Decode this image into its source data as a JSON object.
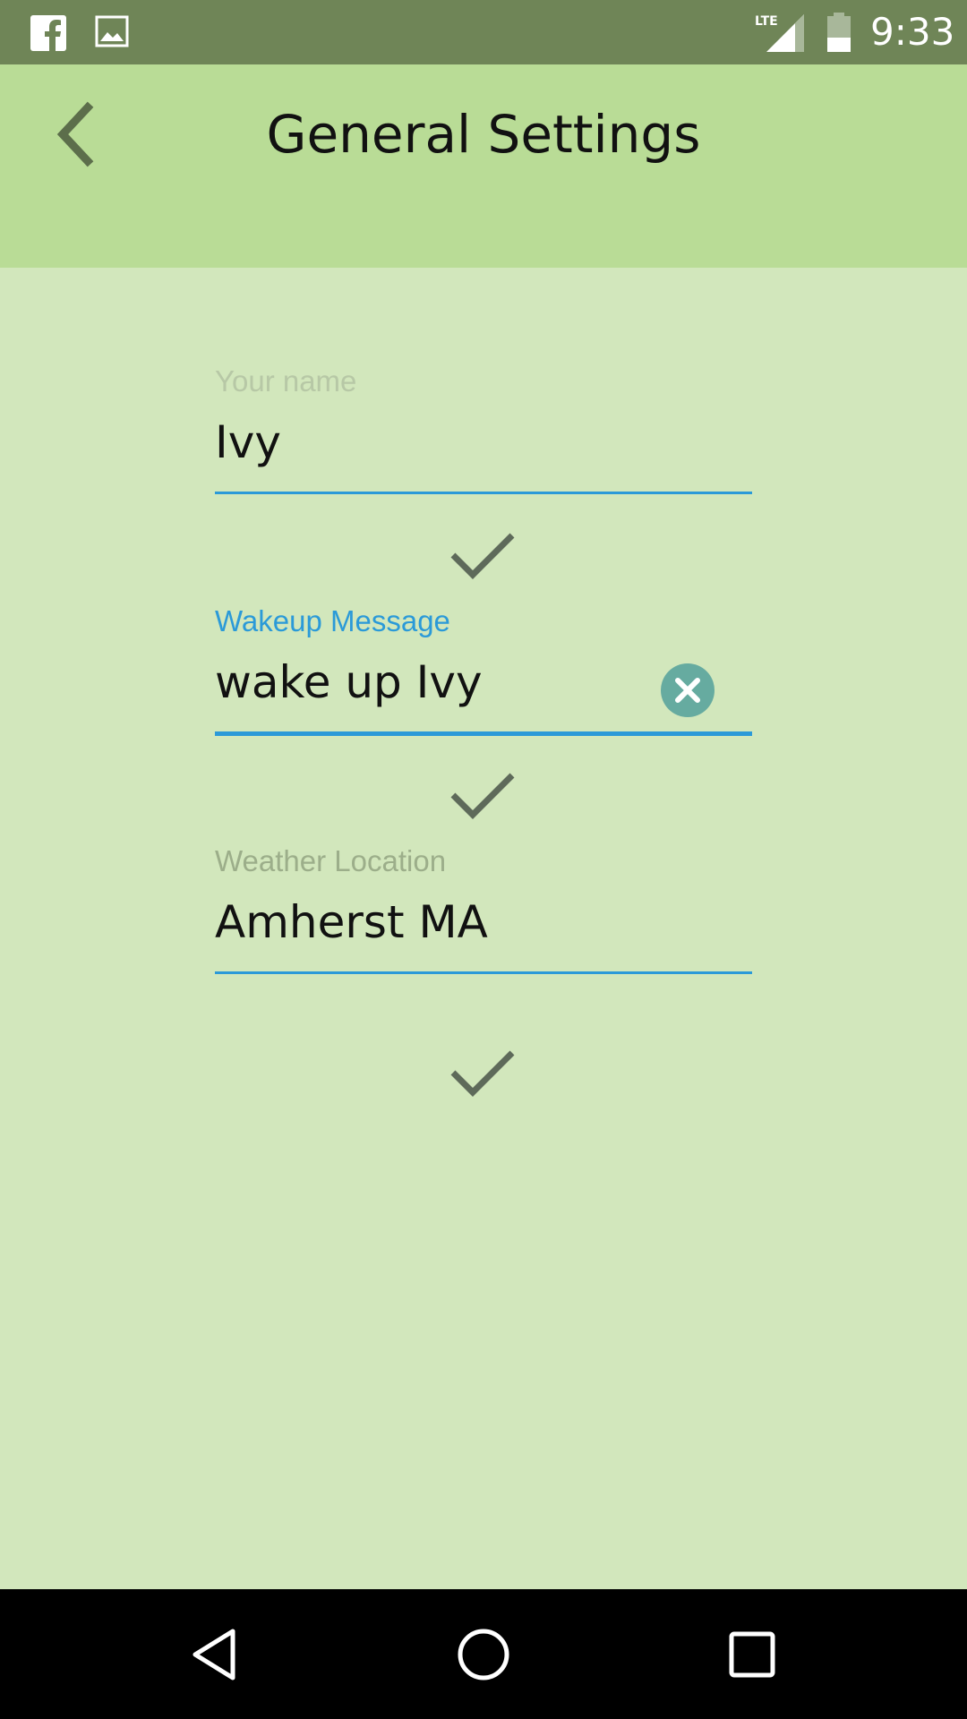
{
  "status_bar": {
    "time": "9:33",
    "network_label": "LTE",
    "icons": [
      "facebook-icon",
      "image-icon",
      "lte-signal-icon",
      "battery-icon"
    ]
  },
  "header": {
    "title": "General Settings",
    "back_icon": "chevron-left-icon"
  },
  "form": {
    "fields": [
      {
        "label": "Your name",
        "value": "Ivy",
        "focused": false
      },
      {
        "label": "Wakeup Message",
        "value": "wake up Ivy",
        "focused": true
      },
      {
        "label": "Weather Location",
        "value": "Amherst MA",
        "focused": false
      }
    ],
    "confirm_icon": "checkmark-icon",
    "clear_icon": "clear-circle-icon"
  },
  "nav_bar": {
    "icons": [
      "back-triangle-icon",
      "home-circle-icon",
      "recents-square-icon"
    ]
  },
  "colors": {
    "status_bar": "#6f8557",
    "app_bar": "#b9dc96",
    "background": "#d2e7bc",
    "accent": "#2b9ad8",
    "inactive_label": "#9cae8a",
    "clear_button": "#66aba0",
    "check": "#5e6a5a"
  }
}
